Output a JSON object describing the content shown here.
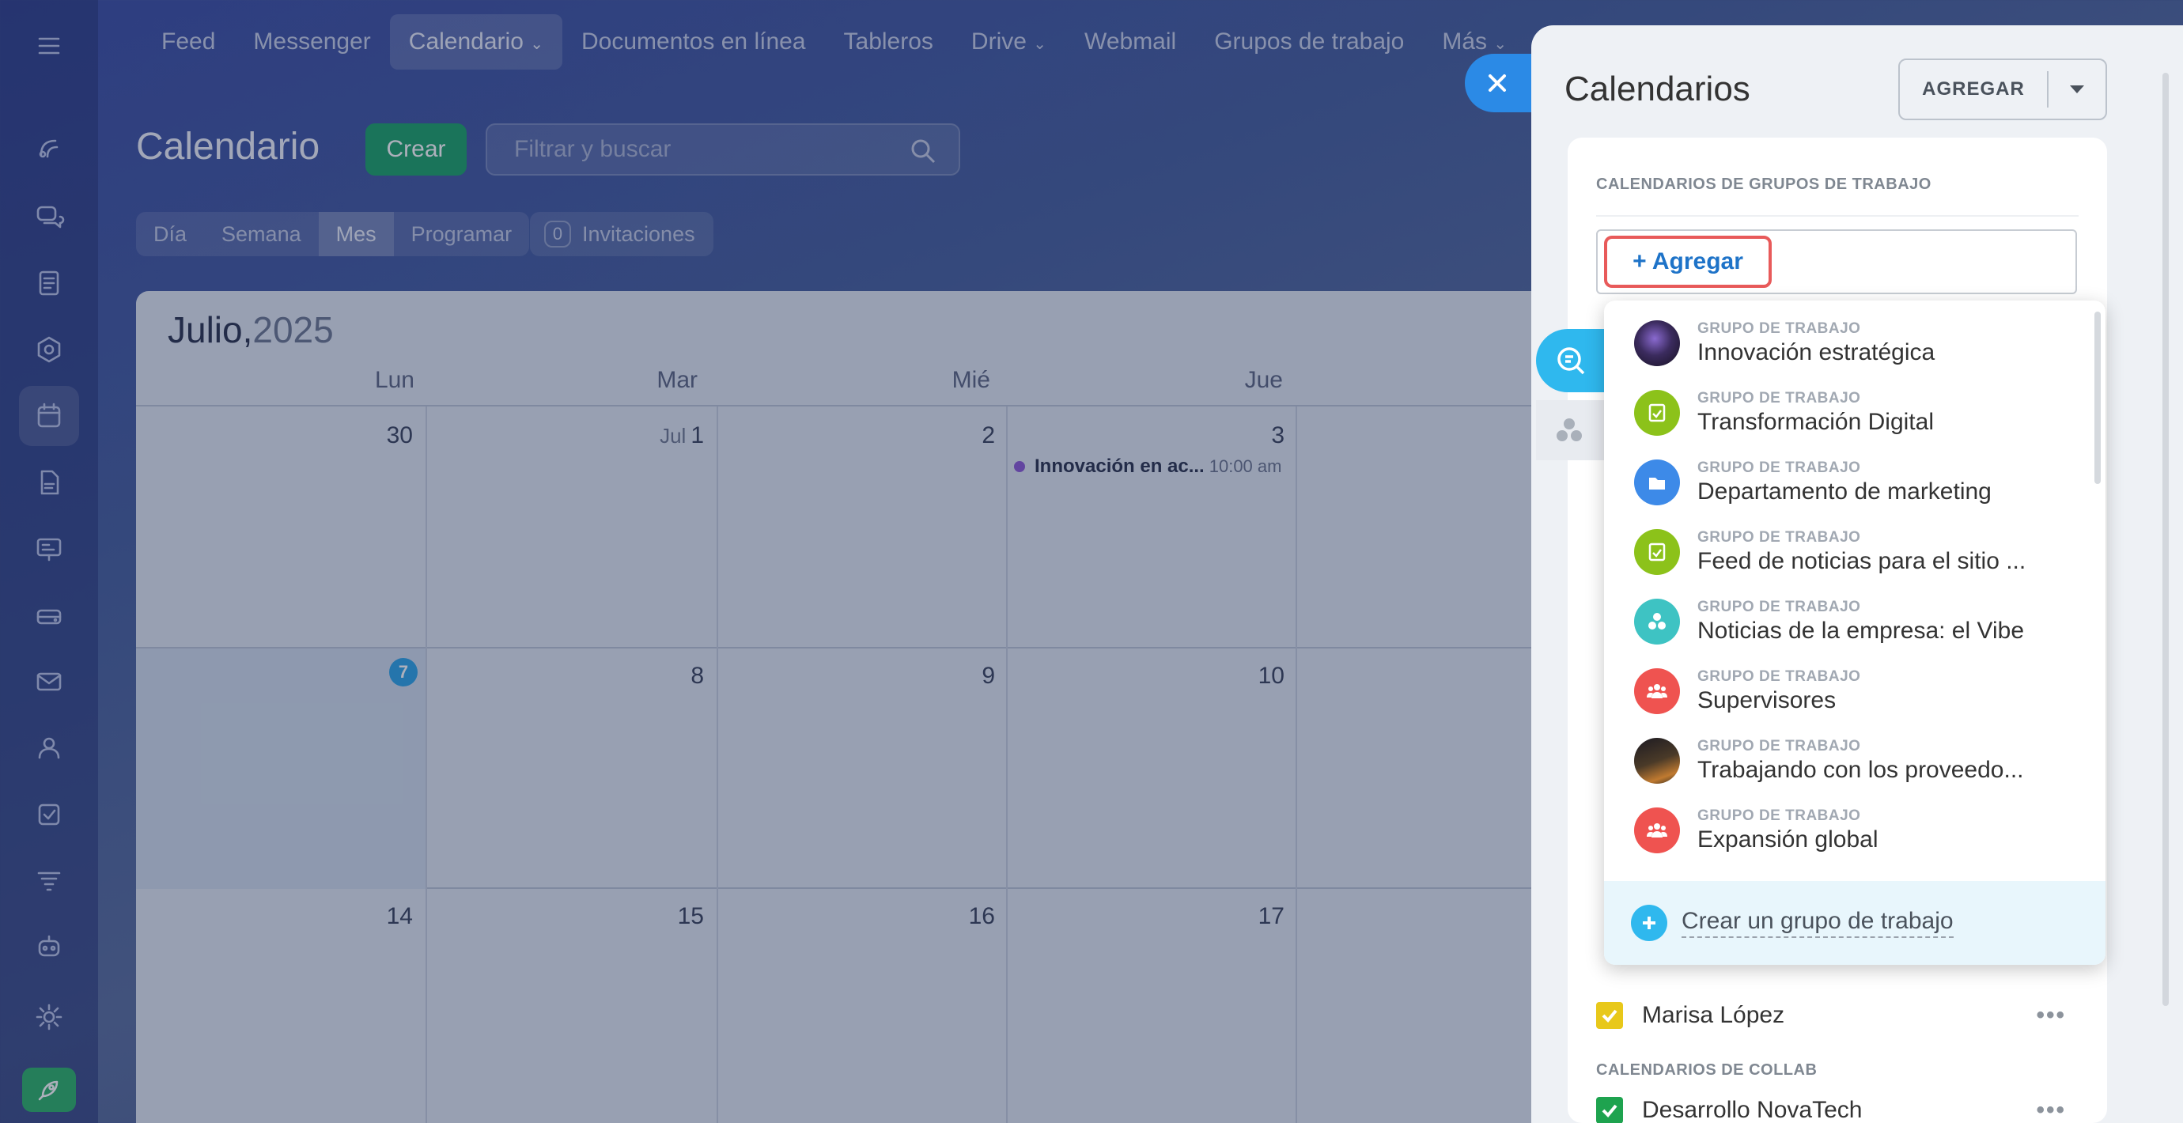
{
  "topnav": {
    "items": [
      "Feed",
      "Messenger",
      "Calendario",
      "Documentos en línea",
      "Tableros",
      "Drive",
      "Webmail",
      "Grupos de trabajo",
      "Más"
    ]
  },
  "main": {
    "title": "Calendario",
    "create_label": "Crear",
    "filter_placeholder": "Filtrar y buscar",
    "view_tabs": [
      "Día",
      "Semana",
      "Mes",
      "Programar"
    ],
    "selected_view": "Mes",
    "invitations_count": "0",
    "invitations_label": "Invitaciones"
  },
  "calendar": {
    "month": "Julio,",
    "year": "2025",
    "weekdays": [
      "Lun",
      "Mar",
      "Mié",
      "Jue"
    ],
    "week1": [
      "30",
      "1",
      "2",
      "3"
    ],
    "week1_month_prefix": "Jul",
    "week2": [
      "7",
      "8",
      "9",
      "10"
    ],
    "week3": [
      "14",
      "15",
      "16",
      "17"
    ],
    "today": "7",
    "event": {
      "title": "Innovación en ac...",
      "time": "10:00 am"
    }
  },
  "panel": {
    "title": "Calendarios",
    "add_label": "AGREGAR",
    "workgroups_section": "CALENDARIOS DE GRUPOS DE TRABAJO",
    "add_link": "+ Agregar",
    "collab_section": "CALENDARIOS DE COLLAB",
    "rows": [
      {
        "name": "Marisa López",
        "color": "#e8c81a"
      },
      {
        "name": "Desarrollo NovaTech",
        "color": "#1ea34f"
      }
    ],
    "more_label": "•••"
  },
  "dropdown": {
    "kind_label": "GRUPO DE TRABAJO",
    "options": [
      {
        "name": "Innovación estratégica",
        "icon": "photo-avatar",
        "color": "#3a2a4a"
      },
      {
        "name": "Transformación Digital",
        "icon": "checklist-icon",
        "color": "#8cc21a"
      },
      {
        "name": "Departamento de marketing",
        "icon": "folder-icon",
        "color": "#3d8ae8"
      },
      {
        "name": "Feed de noticias para el sitio ...",
        "icon": "checklist-icon",
        "color": "#8cc21a"
      },
      {
        "name": "Noticias de la empresa: el Vibe",
        "icon": "circles-icon",
        "color": "#3ec3c3"
      },
      {
        "name": "Supervisores",
        "icon": "people-icon",
        "color": "#ef5350"
      },
      {
        "name": "Trabajando con los proveedo...",
        "icon": "photo-avatar",
        "color": "#5a4630"
      },
      {
        "name": "Expansión global",
        "icon": "people-icon",
        "color": "#ef5350"
      }
    ],
    "create_label": "Crear un grupo de trabajo"
  }
}
